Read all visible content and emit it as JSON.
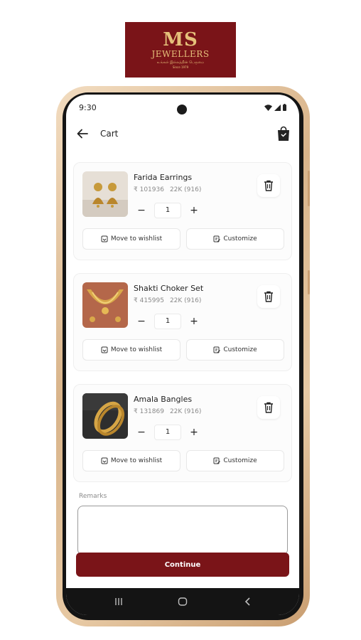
{
  "logo": {
    "monogram": "MS",
    "brand": "JEWELLERS",
    "tagline": "உங்கள் இல்லத்தின் பெருமை",
    "since": "Since 1979"
  },
  "status_bar": {
    "time": "9:30"
  },
  "header": {
    "title": "Cart",
    "back_icon": "arrow-left-icon",
    "bag_icon": "shopping-bag-icon"
  },
  "cart": {
    "items": [
      {
        "name": "Farida Earrings",
        "price": "₹ 101936",
        "purity": "22K (916)",
        "quantity": "1",
        "minus": "−",
        "plus": "+",
        "wishlist_label": "Move to wishlist",
        "customize_label": "Customize"
      },
      {
        "name": "Shakti Choker Set",
        "price": "₹ 415995",
        "purity": "22K (916)",
        "quantity": "1",
        "minus": "−",
        "plus": "+",
        "wishlist_label": "Move to wishlist",
        "customize_label": "Customize"
      },
      {
        "name": "Amala Bangles",
        "price": "₹ 131869",
        "purity": "22K (916)",
        "quantity": "1",
        "minus": "−",
        "plus": "+",
        "wishlist_label": "Move to wishlist",
        "customize_label": "Customize"
      }
    ]
  },
  "remarks": {
    "label": "Remarks",
    "value": ""
  },
  "continue_label": "Continue",
  "colors": {
    "brand": "#7a1418",
    "gold": "#e5c07a"
  }
}
